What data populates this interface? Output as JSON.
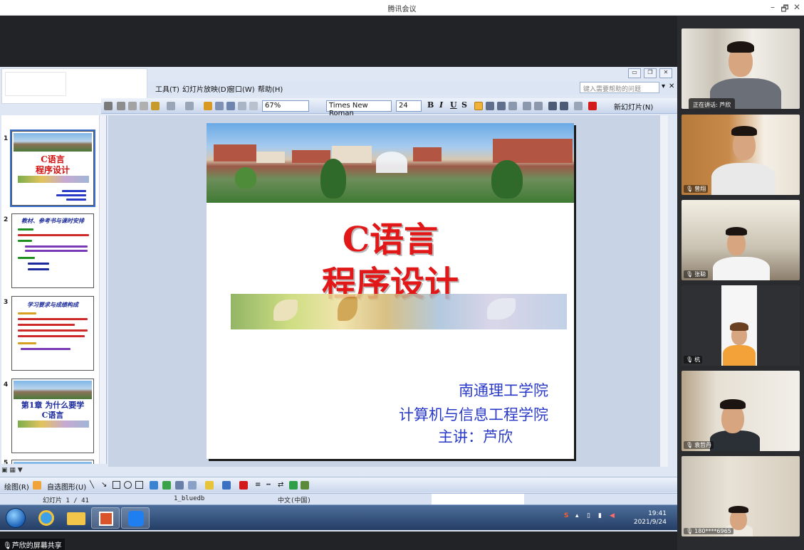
{
  "meeting": {
    "title": "腾讯会议",
    "minimize": "–",
    "restore": "🗗",
    "close": "✕",
    "share_label": "芦欣的屏幕共享"
  },
  "ppt": {
    "menu": [
      "工具(T)",
      "幻灯片放映(D)",
      "窗口(W)",
      "帮助(H)"
    ],
    "help_placeholder": "键入需要帮助的问题",
    "zoom": "67%",
    "font": "Times New Roman",
    "font_size": "24",
    "format_buttons": [
      "B",
      "I",
      "U",
      "S"
    ],
    "new_slide": "新幻灯片(N)",
    "thumbnails": [
      {
        "num": "1",
        "title_lines": [
          "C语言",
          "程序设计"
        ]
      },
      {
        "num": "2",
        "title": "教材、参考书与课时安排"
      },
      {
        "num": "3",
        "title": "学习要求与成绩构成"
      },
      {
        "num": "4",
        "title_lines": [
          "第1章 为什么要学",
          "C语言"
        ]
      },
      {
        "num": "5"
      }
    ],
    "slide": {
      "title_line1": "C语言",
      "title_line2": "程序设计",
      "footer_line1": "南通理工学院",
      "footer_line2": "计算机与信息工程学院",
      "footer_line3": "主讲：芦欣"
    },
    "draw_bar": {
      "draw": "绘图(R)",
      "autoshape": "自选图形(U)"
    },
    "status": {
      "slide_count": "幻灯片 1 / 41",
      "template": "1_bluedb",
      "language": "中文(中国)"
    }
  },
  "taskbar": {
    "time": "19:41",
    "date": "2021/9/24"
  },
  "participants": {
    "speaking_now": "正在讲话: 芦欣",
    "tiles": [
      {
        "name": ""
      },
      {
        "name": "曾翔"
      },
      {
        "name": "张聪"
      },
      {
        "name": "杭"
      },
      {
        "name": "袁哲丹"
      },
      {
        "name": "180****6965"
      }
    ]
  }
}
